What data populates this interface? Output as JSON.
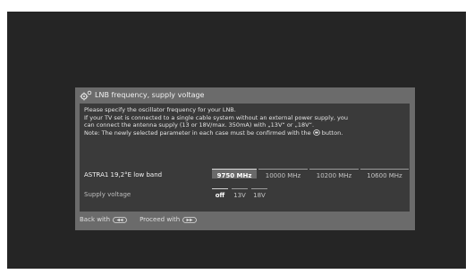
{
  "dialog": {
    "title": "LNB frequency, supply voltage",
    "title_icon": "gear-icon",
    "info_lines": [
      "Please specify the oscillator frequency for your LNB.",
      "If your TV set is connected to a single cable system without an external power supply, you",
      "can connect the antenna supply (13 or 18V/max. 350mA) with „13V“ or „18V“."
    ],
    "note_before": "Note: The newly selected parameter in each case must be confirmed with the",
    "note_after": "button.",
    "note_icon": "ok-button-icon",
    "lnb": {
      "label": "ASTRA1 19,2°E low band",
      "options": [
        "9750 MHz",
        "10000 MHz",
        "10200 MHz",
        "10600 MHz"
      ],
      "selected": "9750 MHz"
    },
    "supply": {
      "label": "Supply voltage",
      "options": [
        "off",
        "13V",
        "18V"
      ],
      "selected": "off"
    },
    "footer": {
      "back_label": "Back with",
      "back_icon": "rewind-key-icon",
      "proceed_label": "Proceed with",
      "proceed_icon": "fast-forward-key-icon"
    }
  },
  "colors": {
    "screen_bg": "#252525",
    "dialog_frame": "#6b6b6b",
    "content_bg": "#3a3a3a",
    "text": "#e3e3e3"
  }
}
